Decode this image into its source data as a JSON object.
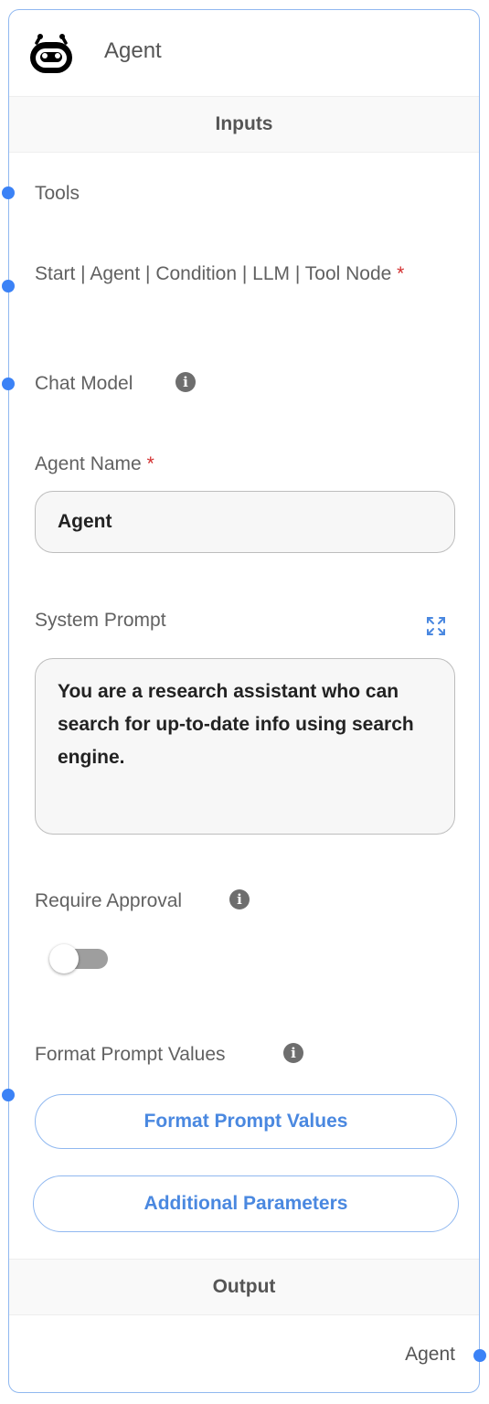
{
  "node": {
    "title": "Agent",
    "icon": "robot-face-icon",
    "accent_color": "#3b82f6",
    "border_color": "#90b8f0"
  },
  "inputs_section": {
    "label": "Inputs"
  },
  "fields": {
    "tools": {
      "label": "Tools"
    },
    "start": {
      "label": "Start | Agent | Condition | LLM | Tool Node",
      "required_mark": "*"
    },
    "chat_model": {
      "label": "Chat Model",
      "info_icon": "info-icon"
    },
    "agent_name": {
      "label": "Agent Name",
      "required_mark": "*",
      "value": "Agent"
    },
    "system_prompt": {
      "label": "System Prompt",
      "value": "You are a research assistant who can search for up-to-date info using search engine.",
      "expand_icon": "expand-icon"
    },
    "require_approval": {
      "label": "Require Approval",
      "enabled": false
    },
    "format_prompt_values": {
      "label": "Format Prompt Values",
      "button_label": "Format Prompt Values"
    }
  },
  "additional_parameters": {
    "label": "Additional Parameters"
  },
  "output_section": {
    "label": "Output",
    "output_label": "Agent"
  }
}
